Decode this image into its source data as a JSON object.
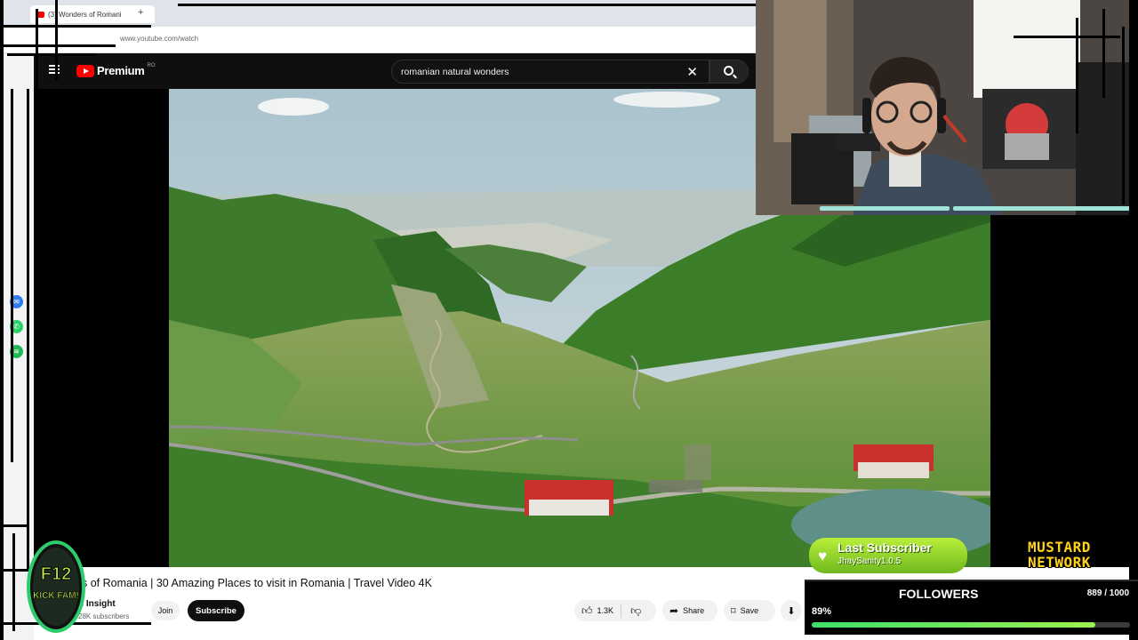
{
  "browser": {
    "tab_title": "(3) Wonders of Romani",
    "new_tab_symbol": "+",
    "url": "www.youtube.com/watch"
  },
  "youtube": {
    "logo_text": "Premium",
    "region": "RO",
    "search_query": "romanian natural wonders",
    "clear_symbol": "✕"
  },
  "video": {
    "title": "s of Romania | 30 Amazing Places to visit in Romania | Travel Video 4K",
    "channel": "n Insight",
    "subscribers": "28K subscribers",
    "join_label": "Join",
    "subscribe_label": "Subscribe",
    "likes": "1.3K",
    "share_label": "Share",
    "save_label": "Save"
  },
  "overlay": {
    "badge_lines": [
      "F12",
      "KICK FAM!"
    ],
    "last_subscriber_title": "Last Subscriber",
    "last_subscriber_name": "JhaySanity1.0.5",
    "network_lines": [
      "MUSTARD",
      "NETWORK"
    ],
    "followers_label": "FOLLOWERS",
    "followers_count": "889 / 1000",
    "followers_percent": "89%",
    "followers_progress": 0.89
  },
  "colors": {
    "youtube_red": "#ff0000",
    "accent_green": "#7fd02a",
    "mustard": "#ffd21f"
  },
  "icons": [
    "hamburger-icon",
    "search-icon",
    "close-icon",
    "like-icon",
    "dislike-icon",
    "share-icon",
    "save-icon",
    "download-icon",
    "messenger-icon",
    "whatsapp-icon",
    "spotify-icon",
    "heart-icon"
  ]
}
